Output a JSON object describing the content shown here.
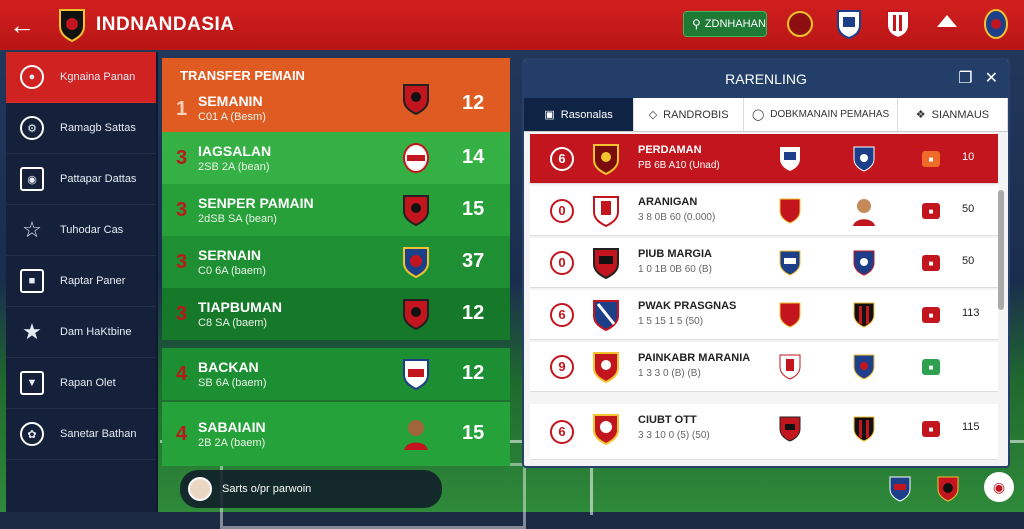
{
  "app": {
    "title": "INDNANDASIA",
    "back_icon": "back-arrow-icon",
    "search_label": "ZDNHAHAN"
  },
  "sidebar": {
    "items": [
      {
        "label": "Kgnaina Panan",
        "icon": "crest-icon"
      },
      {
        "label": "Ramagb Sattas",
        "icon": "gear-icon"
      },
      {
        "label": "Pattapar Dattas",
        "icon": "shield-icon"
      },
      {
        "label": "Tuhodar Cas",
        "icon": "star-icon"
      },
      {
        "label": "Raptar Paner",
        "icon": "boot-icon"
      },
      {
        "label": "Dam HaKtbine",
        "icon": "star-filled-icon"
      },
      {
        "label": "Rapan Olet",
        "icon": "shield-outline-icon"
      },
      {
        "label": "Sanetar Bathan",
        "icon": "settings-icon"
      }
    ]
  },
  "transfer": {
    "title": "TRANSFER PEMAIN",
    "rows": [
      {
        "rank": "1",
        "name": "SEMANIN",
        "sub": "C01 A (Besm)",
        "score": "12",
        "color": "#e05b22"
      },
      {
        "rank": "3",
        "name": "IAGSALAN",
        "sub": "2SB 2A (bean)",
        "score": "14",
        "color": "#35b044"
      },
      {
        "rank": "3",
        "name": "SENPER PAMAIN",
        "sub": "2dSB SA (bean)",
        "score": "15",
        "color": "#27a03a"
      },
      {
        "rank": "3",
        "name": "SERNAIN",
        "sub": "C0 6A (baem)",
        "score": "37",
        "color": "#1f8f33"
      },
      {
        "rank": "3",
        "name": "TIAPBUMAN",
        "sub": "C8 SA (baem)",
        "score": "12",
        "color": "#16792a"
      },
      {
        "rank": "4",
        "name": "BACKAN",
        "sub": "SB 6A (baem)",
        "score": "12",
        "color": "#1b8f31"
      },
      {
        "rank": "4",
        "name": "SABAIAIN",
        "sub": "2B 2A (baem)",
        "score": "15",
        "color": "#25a23a"
      }
    ]
  },
  "ranking": {
    "title": "RARENLING",
    "tools": {
      "copy_icon": "copy-icon",
      "close_icon": "close-icon"
    },
    "tabs": [
      {
        "label": "Rasonalas",
        "icon": "users-icon"
      },
      {
        "label": "RANDROBIS",
        "icon": "tag-icon"
      },
      {
        "label": "DOBKMANAIN PEMAHAS",
        "icon": "trophy-icon"
      },
      {
        "label": "SIANMAUS",
        "icon": "grid-icon"
      }
    ],
    "rows": [
      {
        "pos": "6",
        "club": "PERDAMAN",
        "meta": "PB 6B A10 (Unad)",
        "badge_color": "#f06b2a",
        "pts": "10",
        "highlight": true
      },
      {
        "pos": "0",
        "club": "ARANIGAN",
        "meta": "3 8 0B 60 (0.000)",
        "badge_color": "#c3151d",
        "pts": "50",
        "highlight": false
      },
      {
        "pos": "0",
        "club": "PIUB MARGIA",
        "meta": "1 0 1B 0B 60 (B)",
        "badge_color": "#c3151d",
        "pts": "50",
        "highlight": false
      },
      {
        "pos": "6",
        "club": "PWAK PRASGNAS",
        "meta": "1 5 15 1 5 (50)",
        "badge_color": "#c3151d",
        "pts": "113",
        "highlight": false
      },
      {
        "pos": "9",
        "club": "PAINKABR MARANIA",
        "meta": "1 3 3 0 (B) (B)",
        "badge_color": "#2fa04f",
        "pts": "",
        "highlight": false
      },
      {
        "pos": "6",
        "club": "CIUBT OTT",
        "meta": "3 3 10 0 (5) (50)",
        "badge_color": "#c3151d",
        "pts": "115",
        "highlight": false
      }
    ]
  },
  "status": {
    "text": "Sarts o/pr parwoin"
  },
  "colors": {
    "primary": "#c3151d",
    "navy": "#223e69",
    "green": "#2fa04f"
  }
}
